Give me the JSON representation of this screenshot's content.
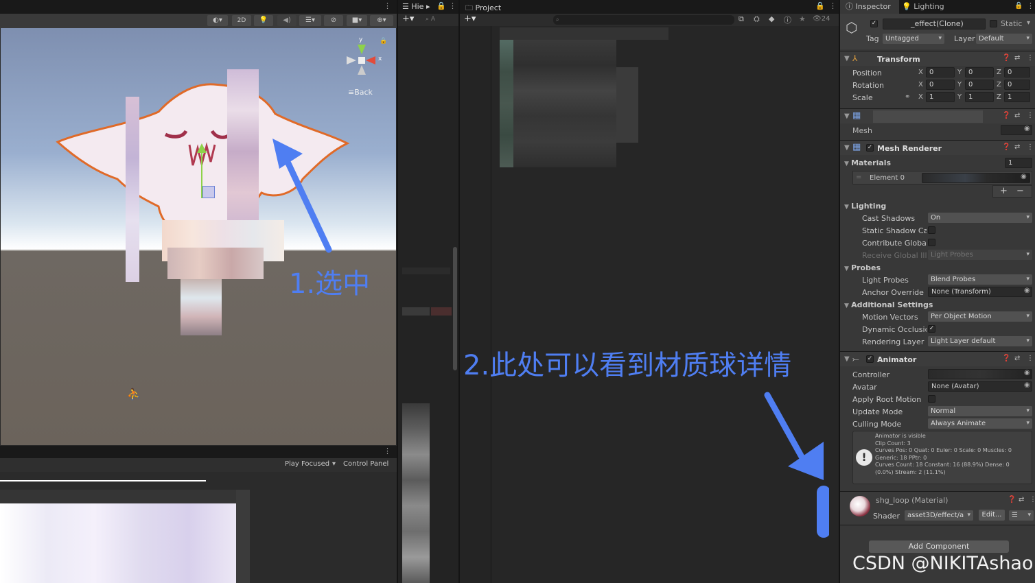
{
  "scene": {
    "toolbar": {
      "mode_2d": "2D"
    },
    "gizmo": {
      "x": "x",
      "y": "y",
      "back": "Back"
    },
    "annotation_select": "1.选中",
    "bottom_bar": {
      "play_focused": "Play Focused",
      "control_panel": "Control Panel"
    }
  },
  "hierarchy": {
    "tab": "Hie"
  },
  "project": {
    "tab": "Project",
    "eye_count": "24",
    "annotation_detail": "2.此处可以看到材质球详情"
  },
  "inspector": {
    "tab_inspector": "Inspector",
    "tab_lighting": "Lighting",
    "object_name": "_effect(Clone)",
    "static_label": "Static",
    "tag_label": "Tag",
    "tag_value": "Untagged",
    "layer_label": "Layer",
    "layer_value": "Default",
    "transform": {
      "title": "Transform",
      "rows": [
        {
          "label": "Position",
          "x": "0",
          "y": "0",
          "z": "0"
        },
        {
          "label": "Rotation",
          "x": "0",
          "y": "0",
          "z": "0"
        },
        {
          "label": "Scale",
          "x": "1",
          "y": "1",
          "z": "1"
        }
      ]
    },
    "mesh_filter": {
      "mesh_label": "Mesh"
    },
    "mesh_renderer": {
      "title": "Mesh Renderer",
      "materials_label": "Materials",
      "materials_count": "1",
      "element0": "Element 0",
      "lighting_label": "Lighting",
      "cast_shadows_label": "Cast Shadows",
      "cast_shadows_value": "On",
      "static_shadow_label": "Static Shadow Cas",
      "contribute_gi_label": "Contribute Global I",
      "receive_gi_label": "Receive Global Illu",
      "receive_gi_value": "Light Probes",
      "probes_label": "Probes",
      "light_probes_label": "Light Probes",
      "light_probes_value": "Blend Probes",
      "anchor_label": "Anchor Override",
      "anchor_value": "None (Transform)",
      "additional_label": "Additional Settings",
      "motion_vectors_label": "Motion Vectors",
      "motion_vectors_value": "Per Object Motion",
      "dynamic_occlusion_label": "Dynamic Occlusion",
      "rendering_layer_label": "Rendering Layer M",
      "rendering_layer_value": "Light Layer default"
    },
    "animator": {
      "title": "Animator",
      "controller_label": "Controller",
      "avatar_label": "Avatar",
      "avatar_value": "None (Avatar)",
      "apply_root_label": "Apply Root Motion",
      "update_mode_label": "Update Mode",
      "update_mode_value": "Normal",
      "culling_label": "Culling Mode",
      "culling_value": "Always Animate",
      "info_lines": [
        "Animator is visible",
        "Clip Count: 3",
        "Curves Pos: 0 Quat: 0 Euler: 0 Scale: 0 Muscles: 0",
        "Generic: 18 PPtr: 0",
        "Curves Count: 18 Constant: 16 (88.9%) Dense: 0",
        "(0.0%) Stream: 2 (11.1%)"
      ]
    },
    "material": {
      "name": "shg_loop (Material)",
      "shader_label": "Shader",
      "shader_value": "asset3D/effect/a",
      "edit_button": "Edit..."
    },
    "add_component": "Add Component",
    "watermark": "CSDN @NIKITAshao"
  }
}
